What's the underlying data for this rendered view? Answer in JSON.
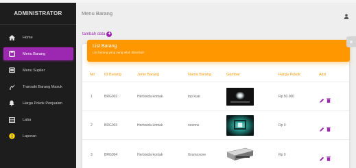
{
  "sidebar": {
    "brand": "ADMINISTRATOR",
    "items": [
      {
        "label": "Home",
        "icon": "home-icon",
        "active": false
      },
      {
        "label": "Menu Barang",
        "icon": "box-icon",
        "active": true
      },
      {
        "label": "Menu Suplier",
        "icon": "layers-icon",
        "active": false
      },
      {
        "label": "Transaki Barang Masuk",
        "icon": "truck-icon",
        "active": false
      },
      {
        "label": "Harga Pokok Penjualan",
        "icon": "bell-icon",
        "active": false
      },
      {
        "label": "Laba",
        "icon": "grid-icon",
        "active": false
      },
      {
        "label": "Laporan",
        "icon": "info-icon",
        "active": false
      }
    ]
  },
  "header": {
    "title": "Menu Barang",
    "user_icon": "person-icon"
  },
  "actions": {
    "add_label": "tambah data"
  },
  "card": {
    "title": "List Barang",
    "subtitle": "List barang yang yang telah ditambah",
    "close_icon": "close-icon"
  },
  "table": {
    "columns": [
      "No",
      "ID Barang",
      "Jenis Barang",
      "Nama Barang",
      "Gambar",
      "Harga Pokok",
      "Aksi"
    ],
    "rows": [
      {
        "no": "1",
        "id": "BRG002",
        "jenis": "Herbisida kontak",
        "nama": "top kuat",
        "harga": "Rp 50.000",
        "image": "square-glow"
      },
      {
        "no": "2",
        "id": "BRG003",
        "jenis": "Herbisida kontak",
        "nama": "noxone",
        "harga": "Rp 0",
        "image": "tunnel"
      },
      {
        "no": "3",
        "id": "BRG004",
        "jenis": "Herbisida kontak",
        "nama": "Gramoxone",
        "harga": "Rp 0",
        "image": "drive"
      }
    ]
  },
  "colors": {
    "accent": "#9c27b0",
    "warning": "#ff9800",
    "sidebar_bg": "#1d1d1d"
  }
}
